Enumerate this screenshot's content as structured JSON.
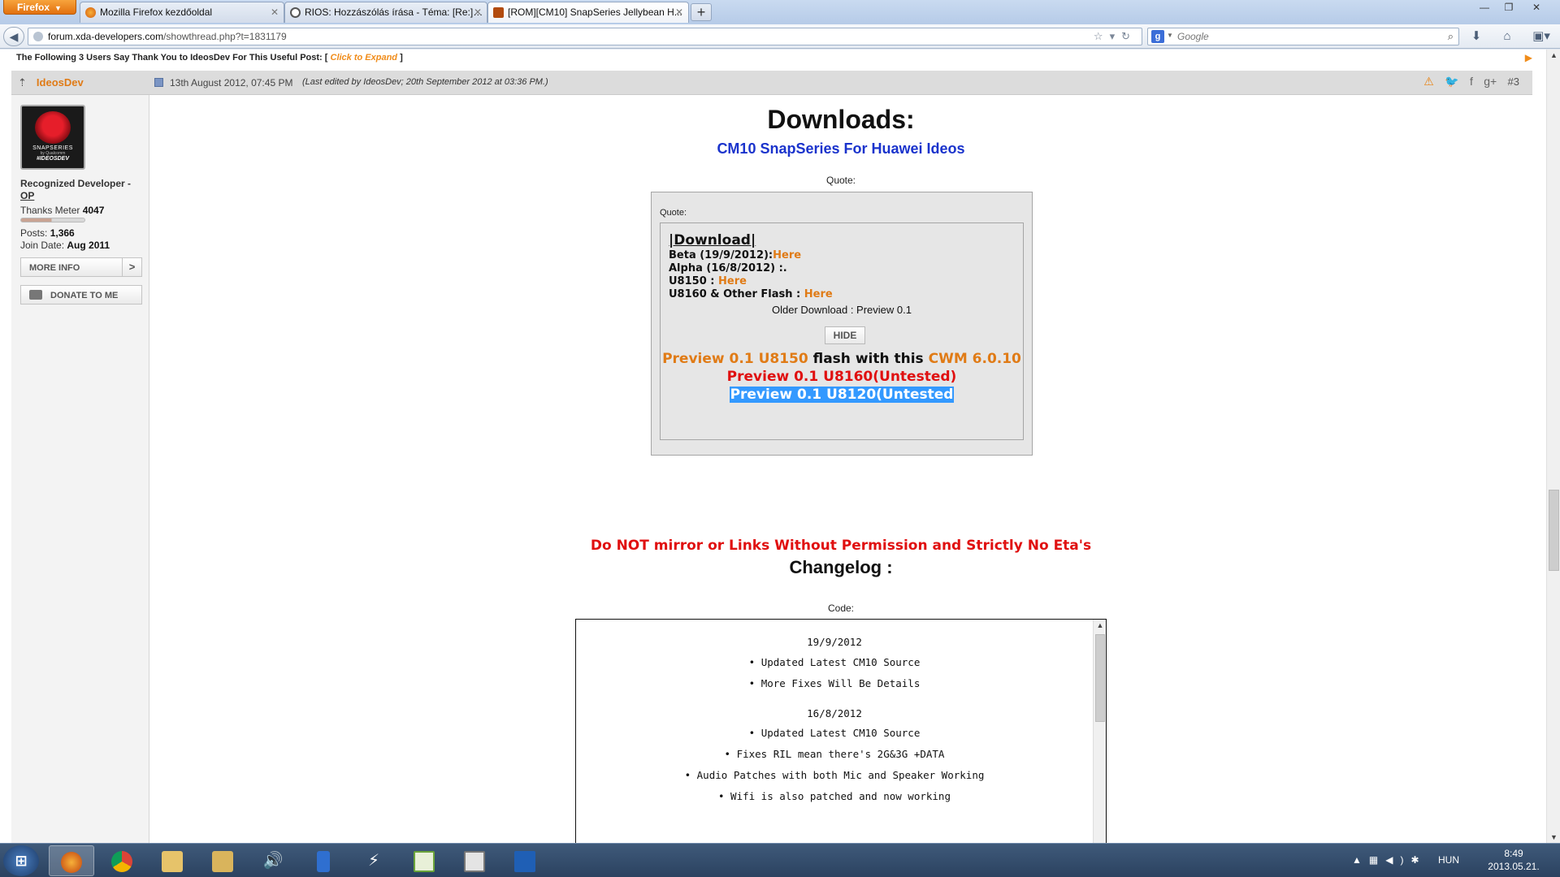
{
  "browser": {
    "menu_label": "Firefox",
    "tabs": [
      {
        "title": "Mozilla Firefox kezdőoldal"
      },
      {
        "title": "RIOS: Hozzászólás írása - Téma: [Re:] ..."
      },
      {
        "title": "[ROM][CM10] SnapSeries Jellybean H..."
      }
    ],
    "url_host": "forum.xda-developers.com",
    "url_path": "/showthread.php?t=1831179",
    "search_placeholder": "Google"
  },
  "thanks_bar": {
    "text": "The Following 3 Users Say Thank You to IdeosDev For This Useful Post: [ ",
    "expand_label": "Click to Expand",
    "close": " ]"
  },
  "post": {
    "author": "IdeosDev",
    "date": "13th August 2012, 07:45 PM",
    "edited": "(Last edited by IdeosDev; 20th September 2012 at 03:36 PM.)",
    "number": "#3"
  },
  "user": {
    "avatar_brand": "SNAPSERIES",
    "avatar_sub": "by Qualcomm",
    "avatar_tag": "#IDEOSDEV",
    "title": "Recognized Developer - ",
    "title_op": "OP",
    "thanks_label": "Thanks Meter ",
    "thanks_value": "4047",
    "thanks_fraction": 0.48,
    "posts_label": "Posts: ",
    "posts_value": "1,366",
    "join_label": "Join Date: ",
    "join_value": "Aug 2011",
    "more_info_label": "MORE INFO",
    "more_info_chevron": ">",
    "donate_label": "DONATE TO ME"
  },
  "downloads": {
    "title": "Downloads:",
    "subtitle": "CM10 SnapSeries For Huawei Ideos",
    "quote_label": "Quote:",
    "inner_quote_label": "Quote:",
    "heading": "|Download|",
    "beta_label": "Beta (19/9/2012):",
    "beta_link": "Here",
    "alpha_label": "Alpha (16/8/2012) :.",
    "u8150_label": "U8150 : ",
    "u8150_link": "Here",
    "u8160_label": "U8160 & Other Flash : ",
    "u8160_link": "Here",
    "older_label": "Older Download : Preview 0.1",
    "hide_label": "HIDE",
    "preview1_link": "Preview 0.1 U8150",
    "preview1_mid": " flash with this ",
    "preview1_cwm": "CWM 6.0.10",
    "preview2": "Preview 0.1 U8160(Untested)",
    "preview3": "Preview 0.1 U8120(Untested"
  },
  "warning": "Do NOT mirror or Links Without Permission and Strictly No Eta's",
  "changelog": {
    "title": "Changelog :",
    "code_label": "Code:",
    "lines": [
      "19/9/2012",
      "• Updated Latest CM10 Source",
      "• More Fixes Will Be Details",
      "16/8/2012",
      "• Updated Latest CM10 Source",
      "• Fixes RIL mean there's 2G&3G +DATA",
      "• Audio Patches with both Mic and Speaker Working",
      "• Wifi is also patched and now working"
    ]
  },
  "taskbar": {
    "language": "HUN",
    "time": "8:49",
    "date": "2013.05.21."
  },
  "colors": {
    "accent_orange": "#e07b16",
    "link_blue": "#1a33cc",
    "warning_red": "#e01010",
    "selection_blue": "#3399ff"
  }
}
